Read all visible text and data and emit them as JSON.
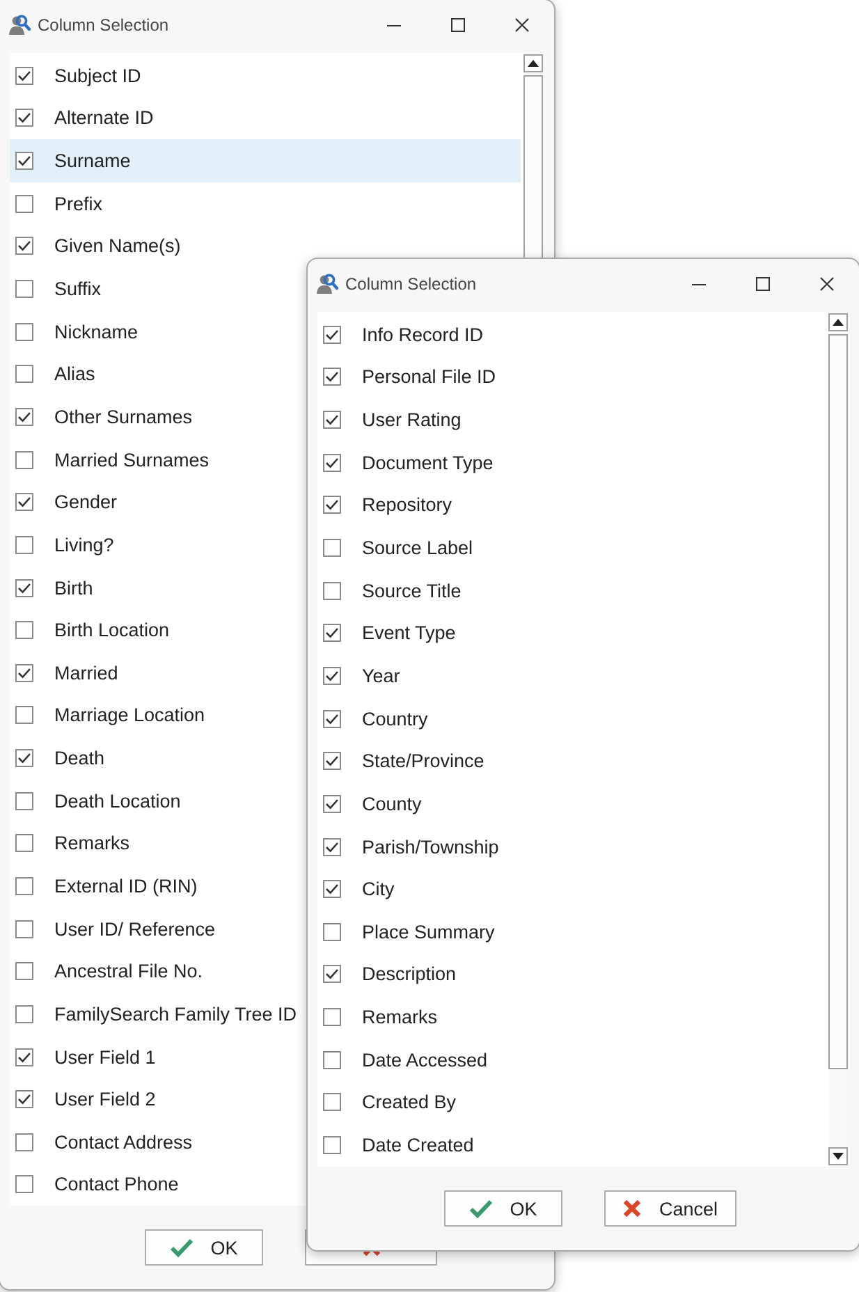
{
  "windows": [
    {
      "title": "Column Selection",
      "items": [
        {
          "label": "Subject ID",
          "checked": true,
          "selected": false
        },
        {
          "label": "Alternate ID",
          "checked": true,
          "selected": false
        },
        {
          "label": "Surname",
          "checked": true,
          "selected": true
        },
        {
          "label": "Prefix",
          "checked": false,
          "selected": false
        },
        {
          "label": "Given Name(s)",
          "checked": true,
          "selected": false
        },
        {
          "label": "Suffix",
          "checked": false,
          "selected": false
        },
        {
          "label": "Nickname",
          "checked": false,
          "selected": false
        },
        {
          "label": "Alias",
          "checked": false,
          "selected": false
        },
        {
          "label": "Other Surnames",
          "checked": true,
          "selected": false
        },
        {
          "label": "Married Surnames",
          "checked": false,
          "selected": false
        },
        {
          "label": "Gender",
          "checked": true,
          "selected": false
        },
        {
          "label": "Living?",
          "checked": false,
          "selected": false
        },
        {
          "label": "Birth",
          "checked": true,
          "selected": false
        },
        {
          "label": "Birth Location",
          "checked": false,
          "selected": false
        },
        {
          "label": "Married",
          "checked": true,
          "selected": false
        },
        {
          "label": "Marriage Location",
          "checked": false,
          "selected": false
        },
        {
          "label": "Death",
          "checked": true,
          "selected": false
        },
        {
          "label": "Death Location",
          "checked": false,
          "selected": false
        },
        {
          "label": "Remarks",
          "checked": false,
          "selected": false
        },
        {
          "label": "External ID (RIN)",
          "checked": false,
          "selected": false
        },
        {
          "label": "User ID/ Reference",
          "checked": false,
          "selected": false
        },
        {
          "label": "Ancestral File No.",
          "checked": false,
          "selected": false
        },
        {
          "label": "FamilySearch Family Tree ID",
          "checked": false,
          "selected": false
        },
        {
          "label": "User Field 1",
          "checked": true,
          "selected": false
        },
        {
          "label": "User Field 2",
          "checked": true,
          "selected": false
        },
        {
          "label": "Contact Address",
          "checked": false,
          "selected": false
        },
        {
          "label": "Contact Phone",
          "checked": false,
          "selected": false
        }
      ],
      "buttons": [
        {
          "kind": "ok",
          "label": "OK"
        },
        {
          "kind": "cancel"
        }
      ]
    },
    {
      "title": "Column Selection",
      "items": [
        {
          "label": "Info Record ID",
          "checked": true,
          "selected": false
        },
        {
          "label": "Personal File ID",
          "checked": true,
          "selected": false
        },
        {
          "label": "User Rating",
          "checked": true,
          "selected": false
        },
        {
          "label": "Document Type",
          "checked": true,
          "selected": false
        },
        {
          "label": "Repository",
          "checked": true,
          "selected": false
        },
        {
          "label": "Source Label",
          "checked": false,
          "selected": false
        },
        {
          "label": "Source Title",
          "checked": false,
          "selected": false
        },
        {
          "label": "Event Type",
          "checked": true,
          "selected": false
        },
        {
          "label": "Year",
          "checked": true,
          "selected": false
        },
        {
          "label": "Country",
          "checked": true,
          "selected": false
        },
        {
          "label": "State/Province",
          "checked": true,
          "selected": false
        },
        {
          "label": "County",
          "checked": true,
          "selected": false
        },
        {
          "label": "Parish/Township",
          "checked": true,
          "selected": false
        },
        {
          "label": "City",
          "checked": true,
          "selected": false
        },
        {
          "label": "Place Summary",
          "checked": false,
          "selected": false
        },
        {
          "label": "Description",
          "checked": true,
          "selected": false
        },
        {
          "label": "Remarks",
          "checked": false,
          "selected": false
        },
        {
          "label": "Date Accessed",
          "checked": false,
          "selected": false
        },
        {
          "label": "Created By",
          "checked": false,
          "selected": false
        },
        {
          "label": "Date Created",
          "checked": false,
          "selected": false
        }
      ],
      "buttons": [
        {
          "kind": "ok",
          "label": "OK"
        },
        {
          "kind": "cancel",
          "label": "Cancel"
        }
      ]
    }
  ]
}
